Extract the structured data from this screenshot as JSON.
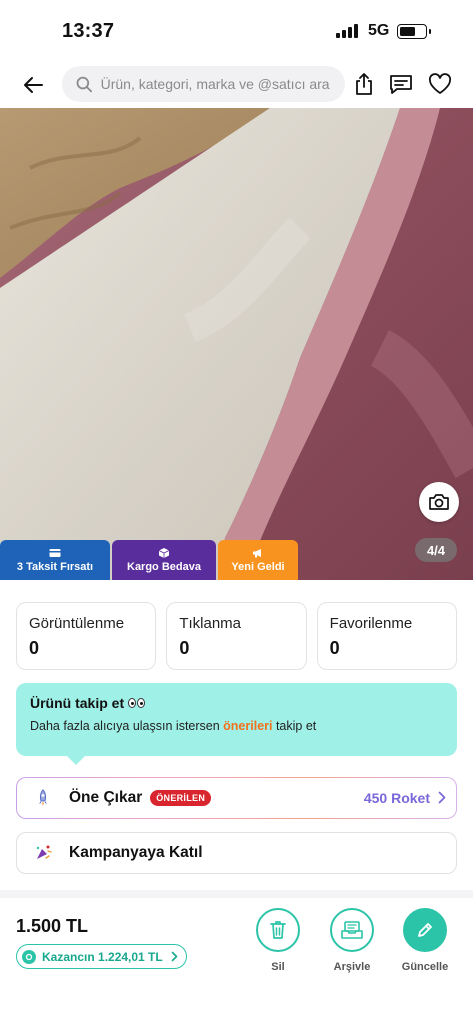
{
  "status_bar": {
    "time": "13:37",
    "network": "5G"
  },
  "header": {
    "search_placeholder": "Ürün, kategori, marka ve @satıcı ara",
    "icons": [
      "back-arrow-icon",
      "search-icon",
      "share-icon",
      "message-icon",
      "heart-icon"
    ]
  },
  "product_image": {
    "page_indicator": "4/4",
    "badges": [
      {
        "label": "3 Taksit Fırsatı",
        "color": "#1e63b8",
        "icon": "card-icon"
      },
      {
        "label": "Kargo Bedava",
        "color": "#5a2d9c",
        "icon": "box-icon"
      },
      {
        "label": "Yeni Geldi",
        "color": "#f7931e",
        "icon": "megaphone-icon"
      }
    ]
  },
  "stats": [
    {
      "label": "Görüntülenme",
      "value": "0"
    },
    {
      "label": "Tıklanma",
      "value": "0"
    },
    {
      "label": "Favorilenme",
      "value": "0"
    }
  ],
  "follow_tip": {
    "title": "Ürünü takip et",
    "text_before": "Daha fazla alıcıya ulaşsın istersen ",
    "link": "önerileri",
    "text_after": " takip et",
    "accent": "#9ff0e6"
  },
  "promote": {
    "label": "Öne Çıkar",
    "badge": "ÖNERİLEN",
    "cost": "450 Roket"
  },
  "campaign": {
    "label": "Kampanyaya Katıl"
  },
  "bottom_bar": {
    "price": "1.500 TL",
    "earnings": "Kazancın 1.224,01 TL",
    "actions": [
      {
        "label": "Sil",
        "icon": "trash-icon"
      },
      {
        "label": "Arşivle",
        "icon": "archive-icon"
      },
      {
        "label": "Güncelle",
        "icon": "pencil-icon"
      }
    ]
  },
  "colors": {
    "brand_teal": "#2cc4a8",
    "orange_link": "#f2711c",
    "roket_purple": "#7a67d9",
    "badge_red": "#d9262e"
  }
}
